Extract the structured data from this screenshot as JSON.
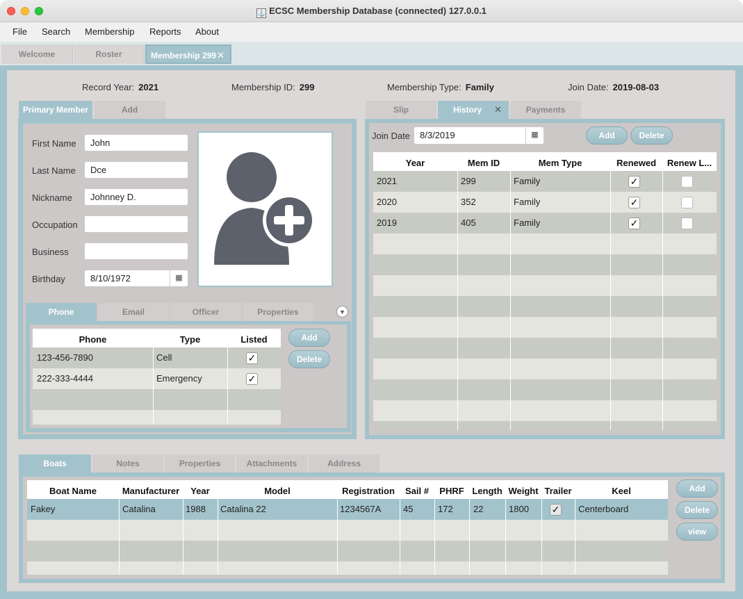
{
  "window": {
    "title": "ECSC Membership Database (connected) 127.0.0.1"
  },
  "menu": [
    "File",
    "Search",
    "Membership",
    "Reports",
    "About"
  ],
  "top_tabs": [
    {
      "label": "Welcome"
    },
    {
      "label": "Roster"
    },
    {
      "label": "Membership 299"
    }
  ],
  "header": {
    "record_year_label": "Record Year:",
    "record_year": "2021",
    "membership_id_label": "Membership ID:",
    "membership_id": "299",
    "membership_type_label": "Membership Type:",
    "membership_type": "Family",
    "join_date_label": "Join Date:",
    "join_date": "2019-08-03"
  },
  "member_tabs": [
    "Primary Member",
    "Add"
  ],
  "member": {
    "first_name_label": "First Name",
    "first_name": "John",
    "last_name_label": "Last Name",
    "last_name": "Dce",
    "nickname_label": "Nickname",
    "nickname": "Johnney D.",
    "occupation_label": "Occupation",
    "occupation": "",
    "business_label": "Business",
    "business": "",
    "birthday_label": "Birthday",
    "birthday": "8/10/1972"
  },
  "contact_tabs": [
    "Phone",
    "Email",
    "Officer",
    "Properties"
  ],
  "phone_table": {
    "headers": [
      "Phone",
      "Type",
      "Listed"
    ],
    "rows": [
      {
        "phone": "123-456-7890",
        "type": "Cell",
        "listed": true
      },
      {
        "phone": "222-333-4444",
        "type": "Emergency",
        "listed": true
      }
    ],
    "add_label": "Add",
    "delete_label": "Delete"
  },
  "history_tabs": [
    "Slip",
    "History",
    "Payments"
  ],
  "history": {
    "join_date_label": "Join Date",
    "join_date": "8/3/2019",
    "add_label": "Add",
    "delete_label": "Delete",
    "headers": [
      "Year",
      "Mem ID",
      "Mem Type",
      "Renewed",
      "Renew L..."
    ],
    "rows": [
      {
        "year": "2021",
        "mem_id": "299",
        "mem_type": "Family",
        "renewed": true,
        "renew_late": false
      },
      {
        "year": "2020",
        "mem_id": "352",
        "mem_type": "Family",
        "renewed": true,
        "renew_late": false
      },
      {
        "year": "2019",
        "mem_id": "405",
        "mem_type": "Family",
        "renewed": true,
        "renew_late": false
      }
    ]
  },
  "boat_tabs": [
    "Boats",
    "Notes",
    "Properties",
    "Attachments",
    "Address"
  ],
  "boats": {
    "headers": [
      "Boat Name",
      "Manufacturer",
      "Year",
      "Model",
      "Registration",
      "Sail #",
      "PHRF",
      "Length",
      "Weight",
      "Trailer",
      "Keel"
    ],
    "rows": [
      {
        "boat_name": "Fakey",
        "manufacturer": "Catalina",
        "year": "1988",
        "model": "Catalina 22",
        "registration": "1234567A",
        "sail": "45",
        "phrf": "172",
        "length": "22",
        "weight": "1800",
        "trailer": true,
        "keel": "Centerboard"
      }
    ],
    "add_label": "Add",
    "delete_label": "Delete",
    "view_label": "view"
  },
  "icons": {
    "close": "close-icon",
    "calendar": "calendar-icon",
    "avatar": "add-user-avatar-icon",
    "dropdown": "chevron-down-icon"
  }
}
